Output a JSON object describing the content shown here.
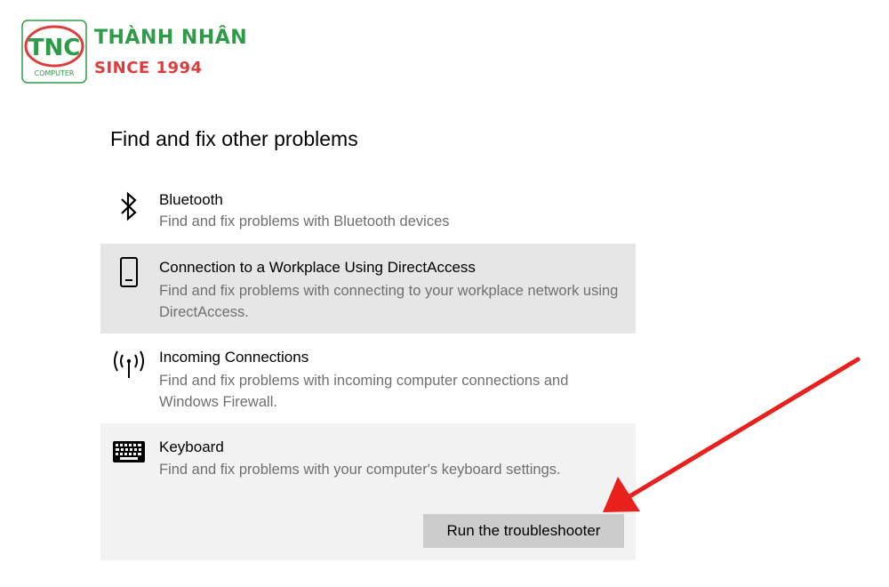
{
  "logo": {
    "abbr": "TNC",
    "sub": "COMPUTER",
    "name": "THÀNH NHÂN",
    "since": "SINCE 1994",
    "green": "#2d9b48",
    "red": "#e03c3c"
  },
  "section": {
    "title": "Find and fix other problems"
  },
  "items": [
    {
      "icon": "bluetooth-icon",
      "title": "Bluetooth",
      "desc": "Find and fix problems with Bluetooth devices",
      "state": "normal"
    },
    {
      "icon": "phone-icon",
      "title": "Connection to a Workplace Using DirectAccess",
      "desc": "Find and fix problems with connecting to your workplace network using DirectAccess.",
      "state": "selected"
    },
    {
      "icon": "antenna-icon",
      "title": "Incoming Connections",
      "desc": "Find and fix problems with incoming computer connections and Windows Firewall.",
      "state": "normal"
    },
    {
      "icon": "keyboard-icon",
      "title": "Keyboard",
      "desc": "Find and fix problems with your computer's keyboard settings.",
      "state": "expanded"
    }
  ],
  "run_button": {
    "label": "Run the troubleshooter"
  },
  "annotation": {
    "icon": "red-arrow-icon",
    "color": "#e8211c"
  }
}
